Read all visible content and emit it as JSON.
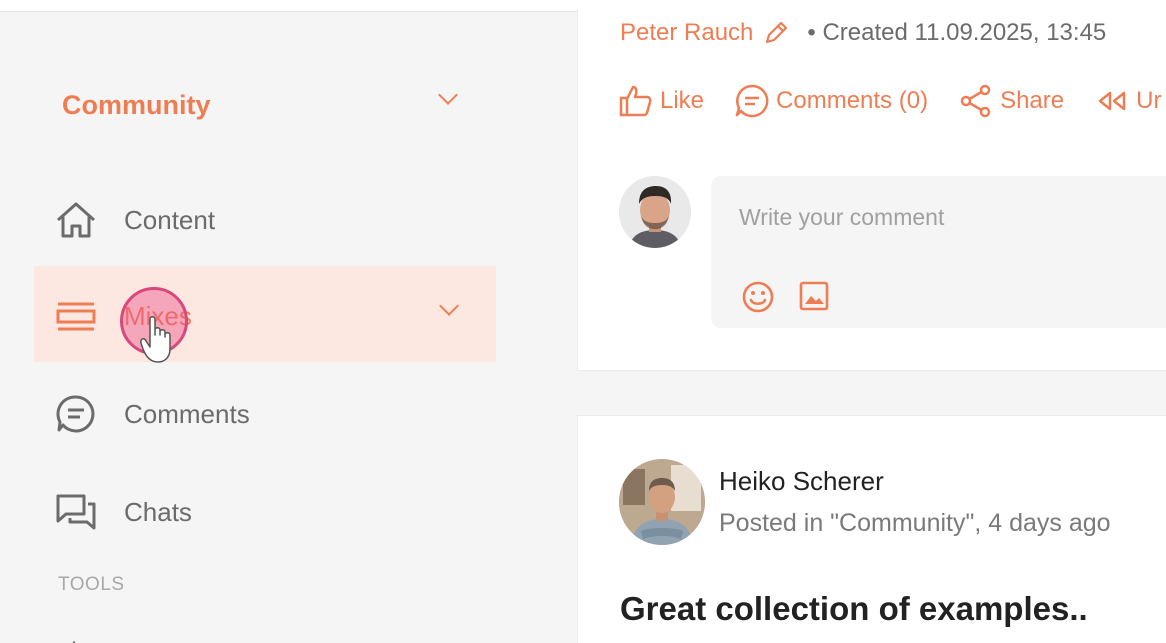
{
  "sidebar": {
    "community_label": "Community",
    "items": [
      {
        "label": "Content",
        "icon": "home-icon"
      },
      {
        "label": "Mixes",
        "icon": "mixes-icon",
        "active": true
      },
      {
        "label": "Comments",
        "icon": "comment-icon"
      },
      {
        "label": "Chats",
        "icon": "chats-icon"
      }
    ],
    "tools_label": "TOOLS"
  },
  "post": {
    "author": "Peter Rauch",
    "created": "• Created 11.09.2025, 13:45",
    "actions": {
      "like": "Like",
      "comments": "Comments (0)",
      "share": "Share",
      "unshare_partial": "Ur"
    },
    "comment_placeholder": "Write your comment"
  },
  "next_post": {
    "author": "Heiko Scherer",
    "meta": "Posted in \"Community\", 4 days ago",
    "title": "Great collection of examples.."
  },
  "colors": {
    "accent": "#ef7d53",
    "active_bg": "#fde8e1",
    "cursor": "#d9477f"
  }
}
